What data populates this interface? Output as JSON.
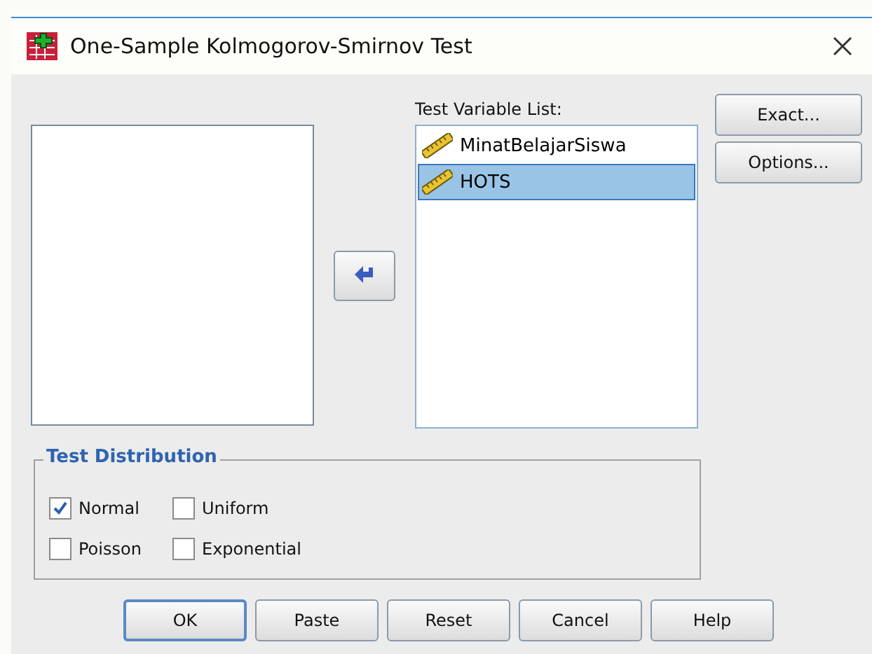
{
  "window": {
    "title": "One-Sample Kolmogorov-Smirnov Test"
  },
  "test_variable_list": {
    "label": "Test Variable List:",
    "items": [
      {
        "name": "MinatBelajarSiswa",
        "selected": false
      },
      {
        "name": "HOTS",
        "selected": true
      }
    ]
  },
  "side_buttons": [
    "Exact...",
    "Options..."
  ],
  "test_distribution": {
    "title": "Test Distribution",
    "options": [
      {
        "label": "Normal",
        "checked": true
      },
      {
        "label": "Uniform",
        "checked": false
      },
      {
        "label": "Poisson",
        "checked": false
      },
      {
        "label": "Exponential",
        "checked": false
      }
    ]
  },
  "buttons": [
    {
      "label": "OK",
      "default": true
    },
    {
      "label": "Paste",
      "default": false
    },
    {
      "label": "Reset",
      "default": false
    },
    {
      "label": "Cancel",
      "default": false
    },
    {
      "label": "Help",
      "default": false
    }
  ]
}
